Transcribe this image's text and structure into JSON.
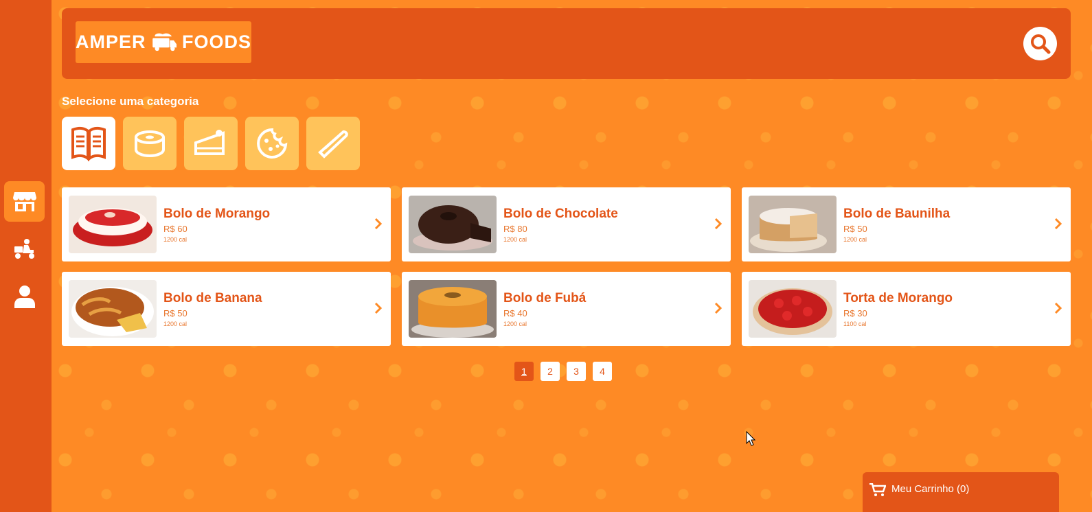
{
  "header": {
    "logo_left": "AMPER",
    "logo_right": "FOODS"
  },
  "sidebar": {
    "items": [
      {
        "icon": "store-icon"
      },
      {
        "icon": "delivery-scooter-icon"
      },
      {
        "icon": "user-icon"
      }
    ]
  },
  "categories": {
    "title": "Selecione uma categoria",
    "items": [
      {
        "icon": "menu-book-icon"
      },
      {
        "icon": "donut-cake-icon"
      },
      {
        "icon": "cake-slice-icon"
      },
      {
        "icon": "cookie-icon"
      },
      {
        "icon": "sandwich-icon"
      }
    ]
  },
  "products": [
    {
      "name": "Bolo de Morango",
      "price": "R$ 60",
      "cal": "1200 cal"
    },
    {
      "name": "Bolo de Chocolate",
      "price": "R$ 80",
      "cal": "1200 cal"
    },
    {
      "name": "Bolo de Baunilha",
      "price": "R$ 50",
      "cal": "1200 cal"
    },
    {
      "name": "Bolo de Banana",
      "price": "R$ 50",
      "cal": "1200 cal"
    },
    {
      "name": "Bolo de Fubá",
      "price": "R$ 40",
      "cal": "1200 cal"
    },
    {
      "name": "Torta de Morango",
      "price": "R$ 30",
      "cal": "1100 cal"
    }
  ],
  "pagination": {
    "pages": [
      "1",
      "2",
      "3",
      "4"
    ],
    "current": "1"
  },
  "cart": {
    "label": "Meu Carrinho (0)"
  },
  "colors": {
    "primary": "#e35518",
    "background": "#fe8a25",
    "category_bg": "#ffc35a"
  }
}
